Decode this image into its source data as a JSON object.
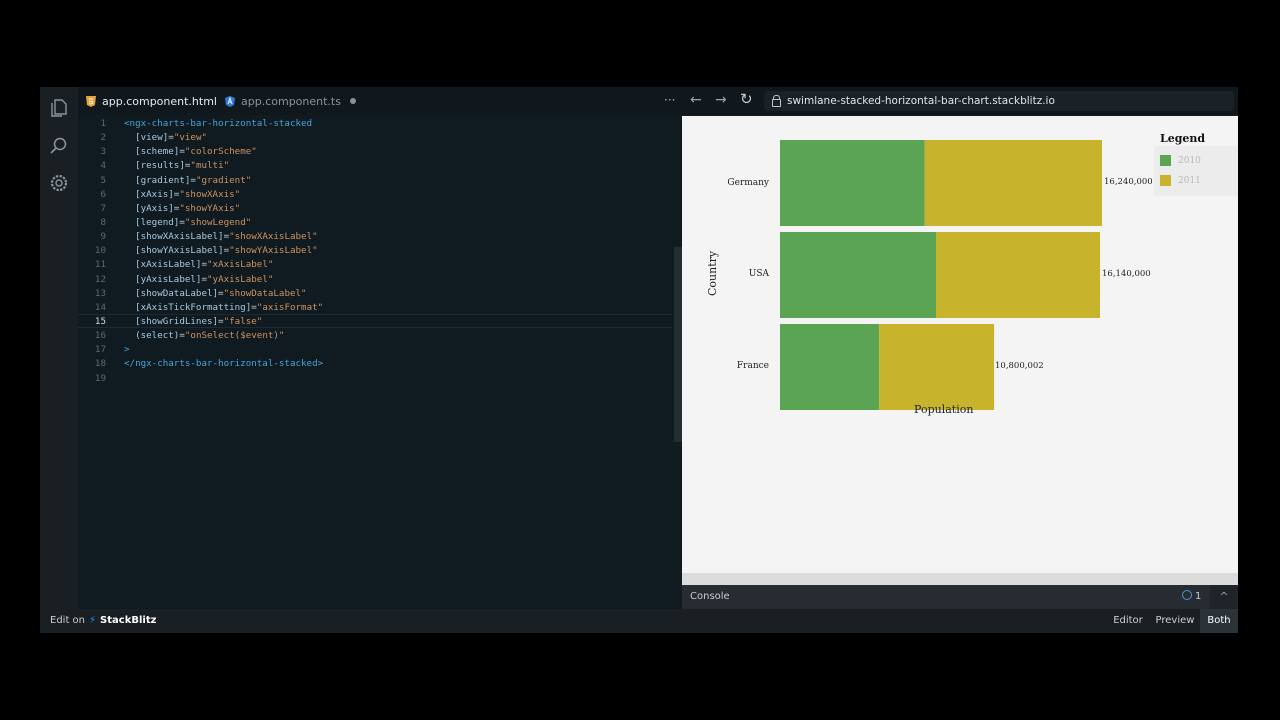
{
  "editor": {
    "tabs": [
      {
        "label": "app.component.html",
        "icon": "html5-icon"
      },
      {
        "label": "app.component.ts",
        "icon": "angular-icon"
      }
    ],
    "more_actions": "···",
    "current_line": 15,
    "lines": [
      {
        "n": "1",
        "parts": [
          [
            "tag",
            "<ngx-charts-bar-horizontal-stacked"
          ]
        ]
      },
      {
        "n": "2",
        "parts": [
          [
            "attr",
            "  [view]"
          ],
          [
            "plain",
            "="
          ],
          [
            "str",
            "\"view\""
          ]
        ]
      },
      {
        "n": "3",
        "parts": [
          [
            "attr",
            "  [scheme]"
          ],
          [
            "plain",
            "="
          ],
          [
            "str",
            "\"colorScheme\""
          ]
        ]
      },
      {
        "n": "4",
        "parts": [
          [
            "attr",
            "  [results]"
          ],
          [
            "plain",
            "="
          ],
          [
            "str",
            "\"multi\""
          ]
        ]
      },
      {
        "n": "5",
        "parts": [
          [
            "attr",
            "  [gradient]"
          ],
          [
            "plain",
            "="
          ],
          [
            "str",
            "\"gradient\""
          ]
        ]
      },
      {
        "n": "6",
        "parts": [
          [
            "attr",
            "  [xAxis]"
          ],
          [
            "plain",
            "="
          ],
          [
            "str",
            "\"showXAxis\""
          ]
        ]
      },
      {
        "n": "7",
        "parts": [
          [
            "attr",
            "  [yAxis]"
          ],
          [
            "plain",
            "="
          ],
          [
            "str",
            "\"showYAxis\""
          ]
        ]
      },
      {
        "n": "8",
        "parts": [
          [
            "attr",
            "  [legend]"
          ],
          [
            "plain",
            "="
          ],
          [
            "str",
            "\"showLegend\""
          ]
        ]
      },
      {
        "n": "9",
        "parts": [
          [
            "attr",
            "  [showXAxisLabel]"
          ],
          [
            "plain",
            "="
          ],
          [
            "str",
            "\"showXAxisLabel\""
          ]
        ]
      },
      {
        "n": "10",
        "parts": [
          [
            "attr",
            "  [showYAxisLabel]"
          ],
          [
            "plain",
            "="
          ],
          [
            "str",
            "\"showYAxisLabel\""
          ]
        ]
      },
      {
        "n": "11",
        "parts": [
          [
            "attr",
            "  [xAxisLabel]"
          ],
          [
            "plain",
            "="
          ],
          [
            "str",
            "\"xAxisLabel\""
          ]
        ]
      },
      {
        "n": "12",
        "parts": [
          [
            "attr",
            "  [yAxisLabel]"
          ],
          [
            "plain",
            "="
          ],
          [
            "str",
            "\"yAxisLabel\""
          ]
        ]
      },
      {
        "n": "13",
        "parts": [
          [
            "attr",
            "  [showDataLabel]"
          ],
          [
            "plain",
            "="
          ],
          [
            "str",
            "\"showDataLabel\""
          ]
        ]
      },
      {
        "n": "14",
        "parts": [
          [
            "attr",
            "  [xAxisTickFormatting]"
          ],
          [
            "plain",
            "="
          ],
          [
            "str",
            "\"axisFormat\""
          ]
        ]
      },
      {
        "n": "15",
        "parts": [
          [
            "attr",
            "  [showGridLines]"
          ],
          [
            "plain",
            "="
          ],
          [
            "str",
            "\"false\""
          ]
        ]
      },
      {
        "n": "16",
        "parts": [
          [
            "attr",
            "  (select)"
          ],
          [
            "plain",
            "="
          ],
          [
            "str",
            "\"onSelect($event)\""
          ]
        ]
      },
      {
        "n": "17",
        "parts": [
          [
            "tag",
            ">"
          ]
        ]
      },
      {
        "n": "18",
        "parts": [
          [
            "tag",
            "</ngx-charts-bar-horizontal-stacked>"
          ]
        ]
      },
      {
        "n": "19",
        "parts": []
      }
    ]
  },
  "preview": {
    "url": "swimlane-stacked-horizontal-bar-chart.stackblitz.io",
    "back": "←",
    "forward": "→",
    "reload": "↻",
    "console_label": "Console",
    "console_count": "1",
    "console_toggle": "^"
  },
  "chart_data": {
    "type": "bar",
    "orientation": "horizontal",
    "stacked": true,
    "categories": [
      "Germany",
      "USA",
      "France"
    ],
    "series": [
      {
        "name": "2010",
        "values": [
          7300000,
          7870000,
          5000002
        ],
        "color": "#5aa454"
      },
      {
        "name": "2011",
        "values": [
          8940000,
          8270000,
          5800000
        ],
        "color": "#c7b42c"
      }
    ],
    "data_labels": [
      "16,240,000",
      "16,140,000",
      "10,800,002"
    ],
    "xlabel": "Population",
    "ylabel": "Country",
    "legend_title": "Legend",
    "legend_position": "right",
    "grid": false,
    "xlim": [
      0,
      16240000
    ]
  },
  "statusbar": {
    "edit_on": "Edit on",
    "brand": "StackBlitz",
    "views": [
      "Editor",
      "Preview",
      "Both"
    ],
    "active_view": "Both"
  },
  "colors": {
    "accent": "#1e90ff",
    "series_2010": "#5aa454",
    "series_2011": "#c7b42c"
  }
}
